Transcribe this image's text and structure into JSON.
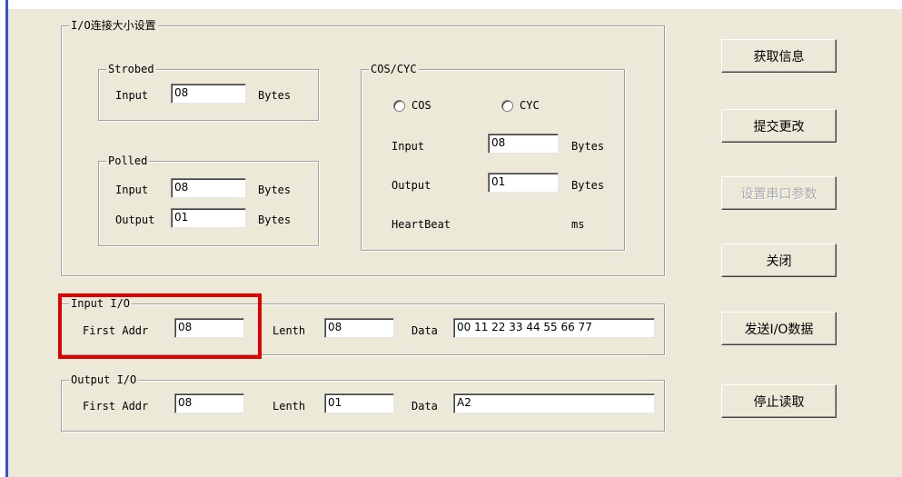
{
  "io_size_group": {
    "title": "I/O连接大小设置"
  },
  "strobed": {
    "title": "Strobed",
    "input_label": "Input",
    "input_value": "08",
    "input_unit": "Bytes"
  },
  "polled": {
    "title": "Polled",
    "input_label": "Input",
    "input_value": "08",
    "input_unit": "Bytes",
    "output_label": "Output",
    "output_value": "01",
    "output_unit": "Bytes"
  },
  "cos_cyc": {
    "title": "COS/CYC",
    "radio_cos": "COS",
    "radio_cyc": "CYC",
    "input_label": "Input",
    "input_value": "08",
    "input_unit": "Bytes",
    "output_label": "Output",
    "output_value": "01",
    "output_unit": "Bytes",
    "heartbeat_label": "HeartBeat",
    "heartbeat_unit": "ms"
  },
  "input_io": {
    "title": "Input I/O",
    "first_addr_label": "First Addr",
    "first_addr_value": "08",
    "length_label": "Lenth",
    "length_value": "08",
    "data_label": "Data",
    "data_value": "00 11 22 33 44 55 66 77"
  },
  "output_io": {
    "title": "Output I/O",
    "first_addr_label": "First Addr",
    "first_addr_value": "08",
    "length_label": "Lenth",
    "length_value": "01",
    "data_label": "Data",
    "data_value": "A2"
  },
  "buttons": {
    "get_info": "获取信息",
    "submit_changes": "提交更改",
    "serial_params": "设置串口参数",
    "close": "关闭",
    "send_io": "发送I/O数据",
    "stop_read": "停止读取"
  },
  "colors": {
    "highlight": "#e00000",
    "window_bg": "#ece9d8",
    "left_bar": "#2f55d4"
  }
}
